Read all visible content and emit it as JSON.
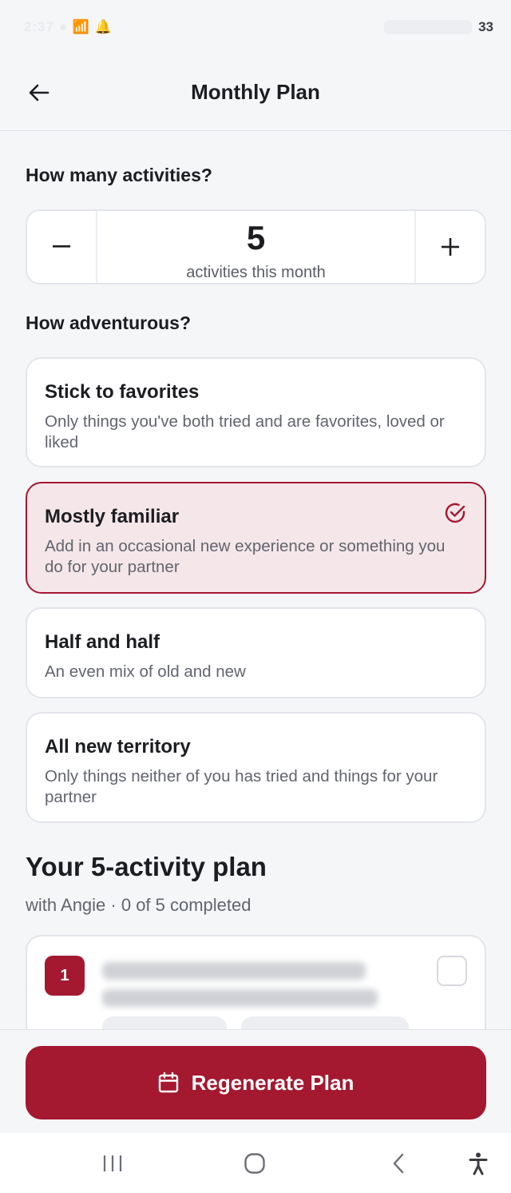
{
  "status_bar": {
    "time_obscured": "2:37 ● 📶 🔔",
    "battery": "33"
  },
  "header": {
    "back_icon": "arrow-left-icon",
    "title": "Monthly Plan"
  },
  "activities": {
    "label": "How many activities?",
    "value": "5",
    "caption": "activities this month",
    "decrement_label": "−",
    "increment_label": "+"
  },
  "adventurous": {
    "label": "How adventurous?",
    "options": [
      {
        "title": "Stick to favorites",
        "description": "Only things you've both tried and are favorites, loved or liked",
        "selected": false
      },
      {
        "title": "Mostly familiar",
        "description": "Add in an occasional new experience or something you do for your partner",
        "selected": true
      },
      {
        "title": "Half and half",
        "description": "An even mix of old and new",
        "selected": false
      },
      {
        "title": "All new territory",
        "description": "Only things neither of you has tried and things for your partner",
        "selected": false
      }
    ]
  },
  "plan": {
    "title": "Your 5-activity plan",
    "subtitle": "with Angie · 0 of 5 completed",
    "items": [
      {
        "number": "1",
        "checked": false
      }
    ]
  },
  "actions": {
    "regenerate_label": "Regenerate Plan",
    "regenerate_icon": "calendar-icon"
  },
  "colors": {
    "accent": "#a41830",
    "selected_bg": "#f5e6e9",
    "background": "#f5f6f8"
  },
  "nav_bar": {
    "icons": [
      "recent-apps-icon",
      "home-icon",
      "back-icon",
      "accessibility-icon"
    ]
  }
}
